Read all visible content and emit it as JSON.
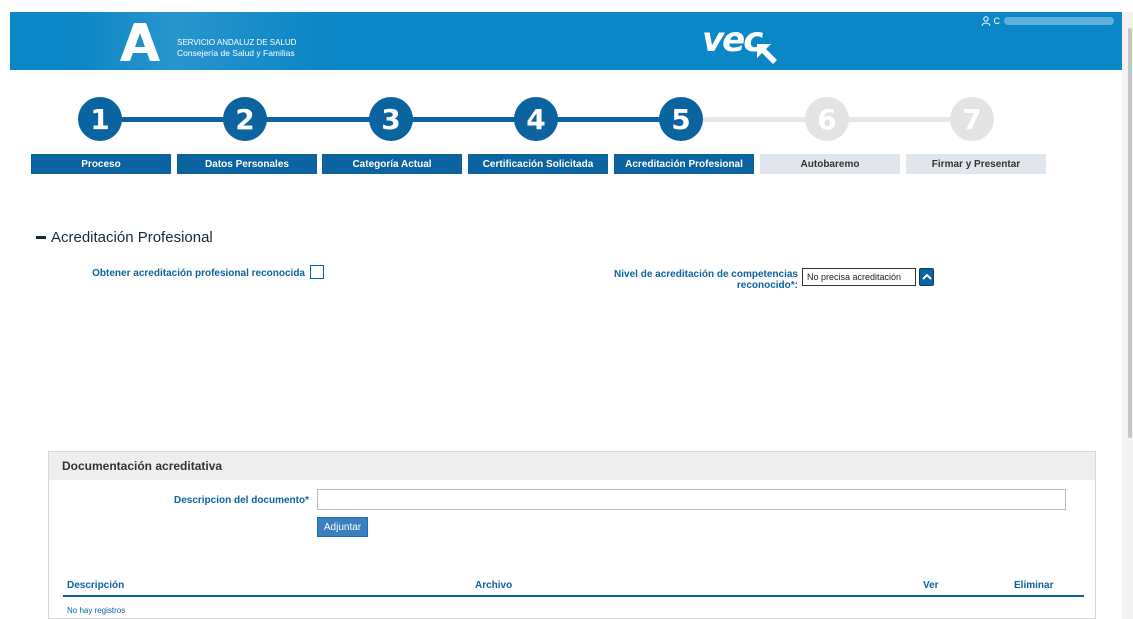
{
  "header": {
    "org_line1": "SERVICIO ANDALUZ DE SALUD",
    "org_line2": "Consejería de Salud y Familias",
    "app_logo": "vec",
    "user_initial": "C",
    "brand_color": "#0b86c6"
  },
  "stepper": {
    "current_step": 5,
    "steps": [
      {
        "number": "1",
        "label": "Proceso",
        "state": "done"
      },
      {
        "number": "2",
        "label": "Datos Personales",
        "state": "done"
      },
      {
        "number": "3",
        "label": "Categoría Actual",
        "state": "done"
      },
      {
        "number": "4",
        "label": "Certificación Solicitada",
        "state": "done"
      },
      {
        "number": "5",
        "label": "Acreditación Profesional",
        "state": "current"
      },
      {
        "number": "6",
        "label": "Autobaremo",
        "state": "todo"
      },
      {
        "number": "7",
        "label": "Firmar y Presentar",
        "state": "todo"
      }
    ]
  },
  "section": {
    "title": "Acreditación Profesional",
    "obtener_label": "Obtener acreditación profesional reconocida",
    "obtener_checked": false,
    "nivel_label": "Nivel de acreditación de competencias reconocido*:",
    "nivel_value": "No precisa acreditación"
  },
  "documentation": {
    "title": "Documentación acreditativa",
    "desc_label": "Descripcion del documento*",
    "desc_value": "",
    "adjuntar_label": "Adjuntar",
    "columns": [
      "Descripción",
      "Archivo",
      "Ver",
      "Eliminar"
    ],
    "empty_text": "No hay registros"
  }
}
